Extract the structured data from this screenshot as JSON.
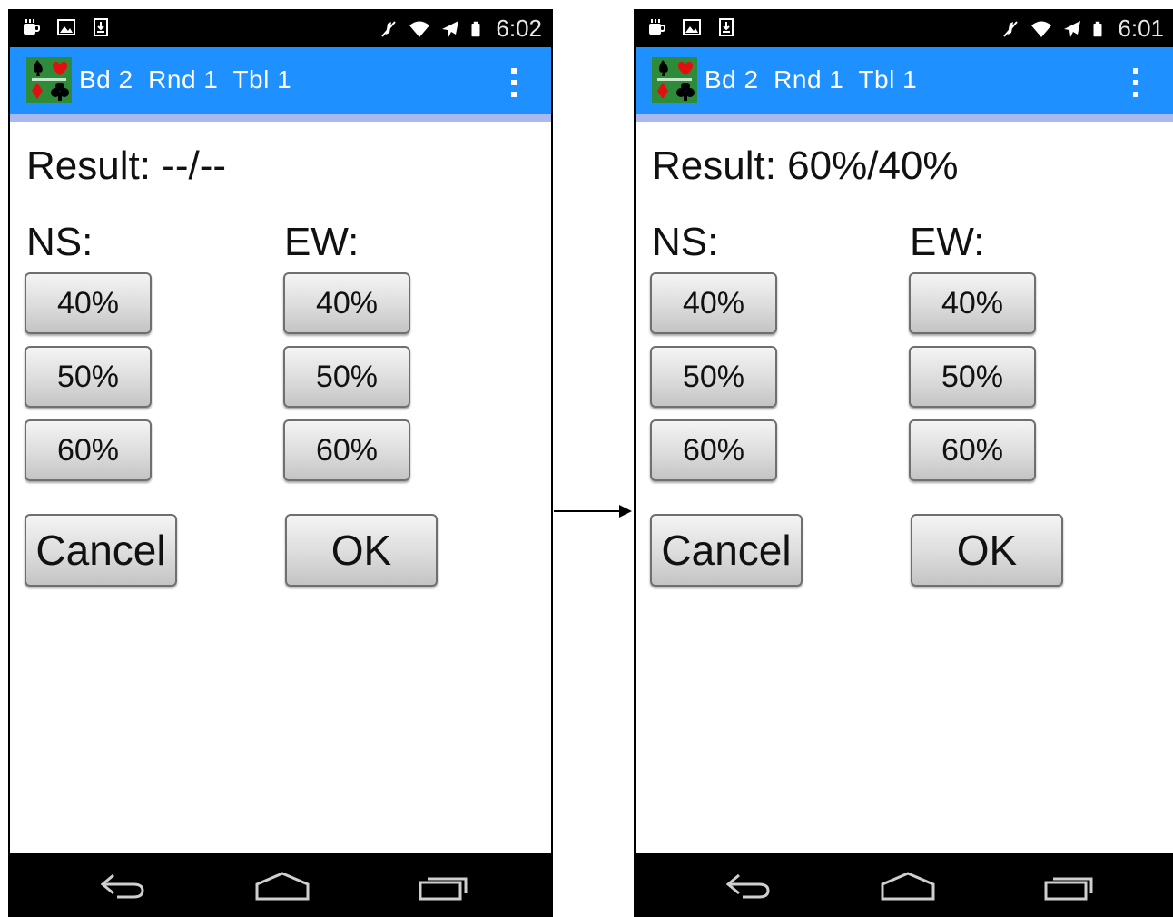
{
  "screens": [
    {
      "status": {
        "time": "6:02"
      },
      "appbar": {
        "title": "Bd 2  Rnd 1  Tbl 1"
      },
      "result": "Result: --/--",
      "ns_label": "NS:",
      "ew_label": "EW:",
      "ns_buttons": [
        "40%",
        "50%",
        "60%"
      ],
      "ew_buttons": [
        "40%",
        "50%",
        "60%"
      ],
      "cancel_label": "Cancel",
      "ok_label": "OK"
    },
    {
      "status": {
        "time": "6:01"
      },
      "appbar": {
        "title": "Bd 2  Rnd 1  Tbl 1"
      },
      "result": "Result: 60%/40%",
      "ns_label": "NS:",
      "ew_label": "EW:",
      "ns_buttons": [
        "40%",
        "50%",
        "60%"
      ],
      "ew_buttons": [
        "40%",
        "50%",
        "60%"
      ],
      "cancel_label": "Cancel",
      "ok_label": "OK"
    }
  ],
  "icons": {
    "status_left": [
      "coffee-icon",
      "image-icon",
      "download-icon"
    ],
    "status_right": [
      "mute-icon",
      "wifi-icon",
      "airplane-icon",
      "battery-icon"
    ],
    "nav": [
      "back-icon",
      "home-icon",
      "recents-icon"
    ],
    "app": "bridge-cards-logo-icon",
    "menu": "overflow-menu-icon"
  },
  "colors": {
    "appbar": "#1e90ff",
    "appbar_border": "#a9b8f0",
    "statusbar": "#000000",
    "navbar": "#000000"
  }
}
